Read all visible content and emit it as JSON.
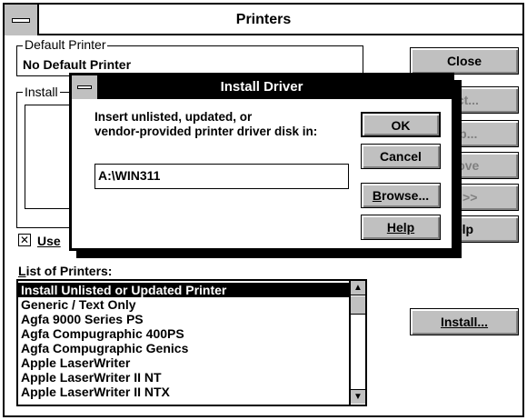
{
  "window": {
    "title": "Printers"
  },
  "default_printer": {
    "group_label": "Default Printer",
    "value": "No Default Printer"
  },
  "installed": {
    "group_label": "Install"
  },
  "use_checkbox": {
    "checked": true,
    "label": "Use"
  },
  "side_buttons": [
    {
      "label": "Close",
      "enabled": true
    },
    {
      "label": "ect...",
      "enabled": false
    },
    {
      "label": "up...",
      "enabled": false
    },
    {
      "label": "nove",
      "enabled": false
    },
    {
      "label": "d >>",
      "enabled": false
    },
    {
      "label": "elp",
      "enabled": true
    }
  ],
  "list": {
    "label": "List of Printers:",
    "items": [
      "Install Unlisted or Updated Printer",
      "Generic / Text Only",
      "Agfa 9000 Series PS",
      "Agfa Compugraphic 400PS",
      "Agfa Compugraphic Genics",
      "Apple LaserWriter",
      "Apple LaserWriter II NT",
      "Apple LaserWriter II NTX"
    ],
    "selected_index": 0
  },
  "install_button": "Install...",
  "dialog": {
    "title": "Install Driver",
    "prompt_line1": "Insert unlisted, updated, or",
    "prompt_line2": "vendor-provided printer driver disk in:",
    "path_value": "A:\\WIN311",
    "ok": "OK",
    "cancel": "Cancel",
    "browse": "Browse...",
    "help": "Help"
  },
  "icons": {
    "system_menu": "system-menu-icon",
    "scroll_up": "▲",
    "scroll_down": "▼",
    "checkbox_mark": "✕"
  }
}
